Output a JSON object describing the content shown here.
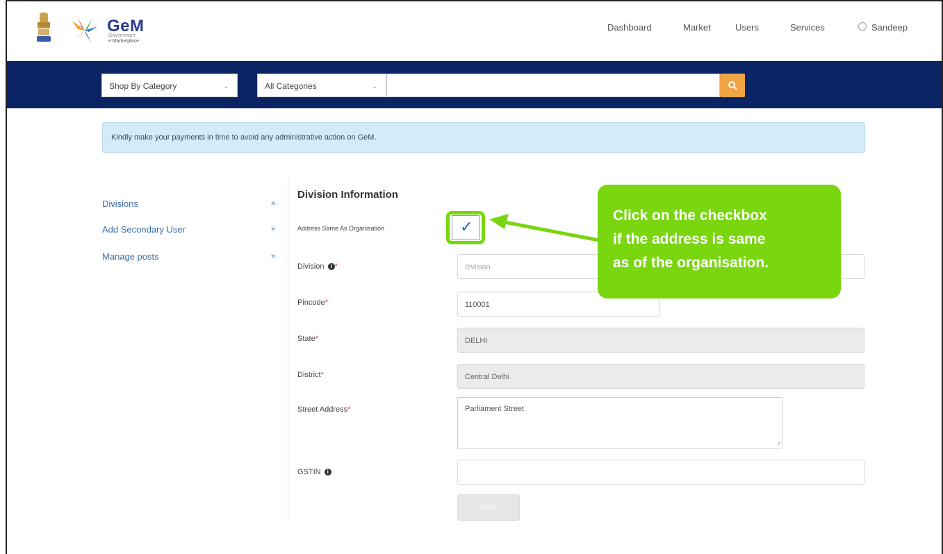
{
  "header": {
    "brand_title": "GeM",
    "brand_sub1": "Government",
    "brand_sub2": "e Marketplace",
    "nav": [
      "Dashboard",
      "Market",
      "Users",
      "Services"
    ],
    "user_name": "Sandeep"
  },
  "search": {
    "category_select": "Shop By Category",
    "all_categories_select": "All Categories",
    "query": ""
  },
  "notice": "Kindly make your payments in time to avoid any administrative action on GeM.",
  "sidebar": {
    "items": [
      {
        "label": "Divisions",
        "chevron": "»"
      },
      {
        "label": "Add Secondary User",
        "chevron": "»"
      },
      {
        "label": "Manage posts",
        "chevron": "»"
      }
    ]
  },
  "form": {
    "title": "Division Information",
    "address_same_label": "Address Same As Organisation",
    "address_same_checked": true,
    "division_label": "Division",
    "division_placeholder": "division",
    "pincode_label": "Pincode",
    "pincode_value": "110001",
    "state_label": "State",
    "state_value": "DELHI",
    "district_label": "District",
    "district_value": "Central Delhi",
    "street_label": "Street Address",
    "street_value": "Parliament Street",
    "gstin_label": "GSTIN",
    "gstin_value": "",
    "add_label": "ADD"
  },
  "callout": {
    "line1": "Click on the checkbox",
    "line2": "if the address is same",
    "line3": "as of the organisation."
  },
  "colors": {
    "nav_band": "#0a2464",
    "search_button": "#f0a545",
    "callout": "#79d60f",
    "link": "#3d6ea6",
    "notice_bg": "#d4ecf8"
  }
}
